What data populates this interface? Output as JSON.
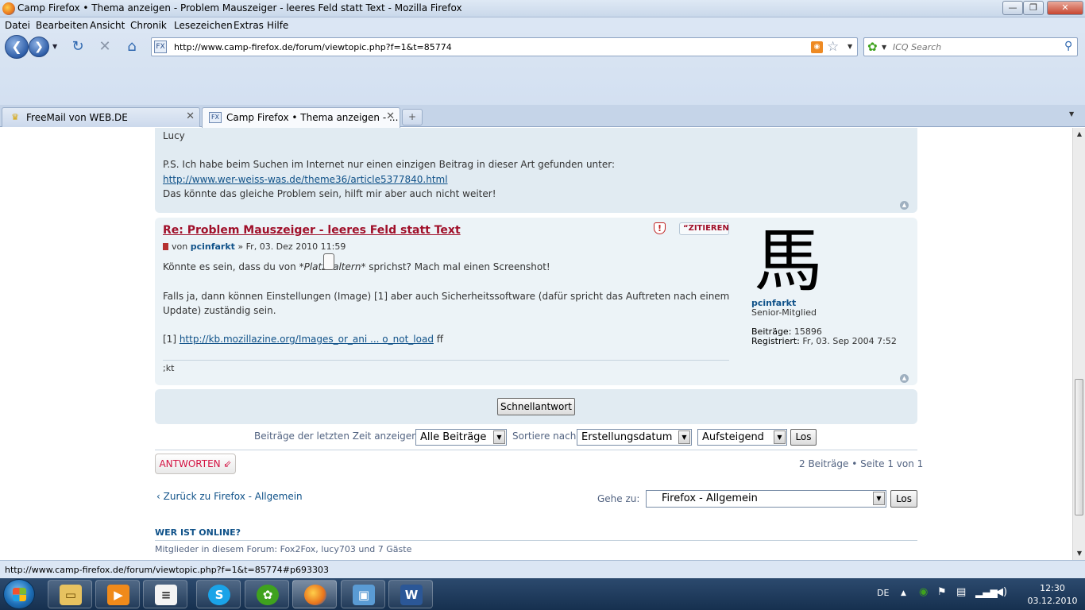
{
  "window": {
    "title": "Camp Firefox • Thema anzeigen - Problem Mauszeiger - leeres Feld statt Text - Mozilla Firefox",
    "min": "—",
    "max": "❐",
    "close": "✕"
  },
  "menu": [
    "Datei",
    "Bearbeiten",
    "Ansicht",
    "Chronik",
    "Lesezeichen",
    "Extras",
    "Hilfe"
  ],
  "nav": {
    "url": "http://www.camp-firefox.de/forum/viewtopic.php?f=1&t=85774",
    "search_placeholder": "ICQ Search"
  },
  "tabs": [
    {
      "label": "FreeMail von WEB.DE",
      "active": false
    },
    {
      "label": "Camp Firefox • Thema anzeigen - ...",
      "active": true
    }
  ],
  "post1": {
    "signoff": "Lucy",
    "ps": "P.S. Ich habe beim Suchen im Internet nur einen einzigen Beitrag in dieser Art gefunden unter:",
    "link": "http://www.wer-weiss-was.de/theme36/article5377840.html",
    "after": "Das könnte das gleiche Problem sein, hilft mir aber auch nicht weiter!"
  },
  "post2": {
    "title": "Re: Problem Mauszeiger - leeres Feld statt Text",
    "by": "von",
    "author": "pcinfarkt",
    "date": "» Fr, 03. Dez 2010 11:59",
    "quote_label": "ZITIEREN",
    "line1_a": "Könnte es sein, dass du von *",
    "line1_em": "Platzhaltern",
    "line1_b": "* sprichst? Mach mal einen Screenshot!",
    "line2": "Falls ja, dann können Einstellungen (Image) [1] aber auch Sicherheitssoftware (dafür spricht das Auftreten nach einem",
    "line3": "Update) zuständig sein.",
    "ref_prefix": "[1]",
    "ref_link": "http://kb.mozillazine.org/Images_or_ani ... o_not_load",
    "ref_suffix": "ff",
    "signature": ";kt",
    "avatar_glyph": "馬",
    "profile": {
      "name": "pcinfarkt",
      "rank": "Senior-Mitglied",
      "posts_label": "Beiträge:",
      "posts": "15896",
      "reg_label": "Registriert:",
      "reg": "Fr, 03. Sep 2004 7:52"
    }
  },
  "quickreply": {
    "label": "Schnellantwort"
  },
  "filter": {
    "label1": "Beiträge der letzten Zeit anzeigen:",
    "select1": "Alle Beiträge",
    "label2": "Sortiere nach",
    "select2": "Erstellungsdatum",
    "select3": "Aufsteigend",
    "go": "Los"
  },
  "reply": {
    "label": "ANTWORTEN ⇙"
  },
  "pagination": "2 Beiträge • Seite 1 von 1",
  "back": {
    "label": "Zurück zu Firefox - Allgemein"
  },
  "jump": {
    "label": "Gehe zu:",
    "select": "Firefox  -  Allgemein",
    "go": "Los"
  },
  "online": {
    "heading": "WER IST ONLINE?",
    "text": "Mitglieder in diesem Forum: Fox2Fox, lucy703 und 7 Gäste"
  },
  "status": "http://www.camp-firefox.de/forum/viewtopic.php?f=1&t=85774#p693303",
  "taskbar": {
    "lang": "DE",
    "time": "12:30",
    "date": "03.12.2010"
  }
}
